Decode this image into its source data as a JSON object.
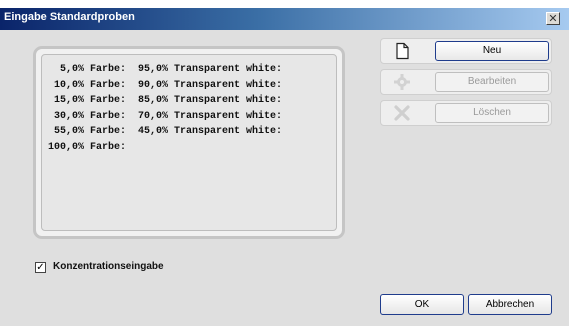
{
  "window": {
    "title": "Eingabe Standardproben",
    "close_symbol": "✕"
  },
  "list": {
    "lines": [
      "  5,0% Farbe:  95,0% Transparent white:",
      " 10,0% Farbe:  90,0% Transparent white:",
      " 15,0% Farbe:  85,0% Transparent white:",
      " 30,0% Farbe:  70,0% Transparent white:",
      " 55,0% Farbe:  45,0% Transparent white:",
      "100,0% Farbe:"
    ]
  },
  "actions": {
    "new_label": "Neu",
    "new_icon": "document-icon",
    "edit_label": "Bearbeiten",
    "edit_icon": "gear-icon",
    "delete_label": "Löschen",
    "delete_icon": "delete-x-icon"
  },
  "options": {
    "concentration_label": "Konzentrationseingabe",
    "concentration_checked": true,
    "check_symbol": "✓"
  },
  "footer": {
    "ok_label": "OK",
    "cancel_label": "Abbrechen"
  }
}
